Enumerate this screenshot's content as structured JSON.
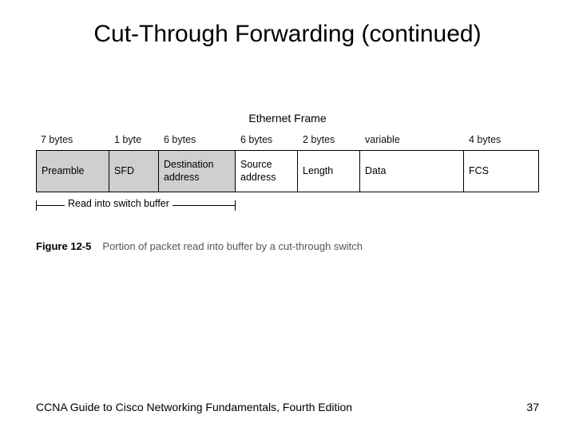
{
  "title": "Cut-Through Forwarding (continued)",
  "frame_title": "Ethernet Frame",
  "columns": [
    {
      "size": "7 bytes",
      "name": "Preamble",
      "shaded": true
    },
    {
      "size": "1 byte",
      "name": "SFD",
      "shaded": true
    },
    {
      "size": "6 bytes",
      "name": "Destination address",
      "shaded": true
    },
    {
      "size": "6 bytes",
      "name": "Source address",
      "shaded": false
    },
    {
      "size": "2 bytes",
      "name": "Length",
      "shaded": false
    },
    {
      "size": "variable",
      "name": "Data",
      "shaded": false
    },
    {
      "size": "4 bytes",
      "name": "FCS",
      "shaded": false
    }
  ],
  "bracket_label": "Read into switch buffer",
  "figure_label": "Figure 12-5",
  "figure_caption": "Portion of packet read into buffer by a cut-through switch",
  "footer_left": "CCNA Guide to Cisco Networking Fundamentals, Fourth Edition",
  "footer_right": "37"
}
